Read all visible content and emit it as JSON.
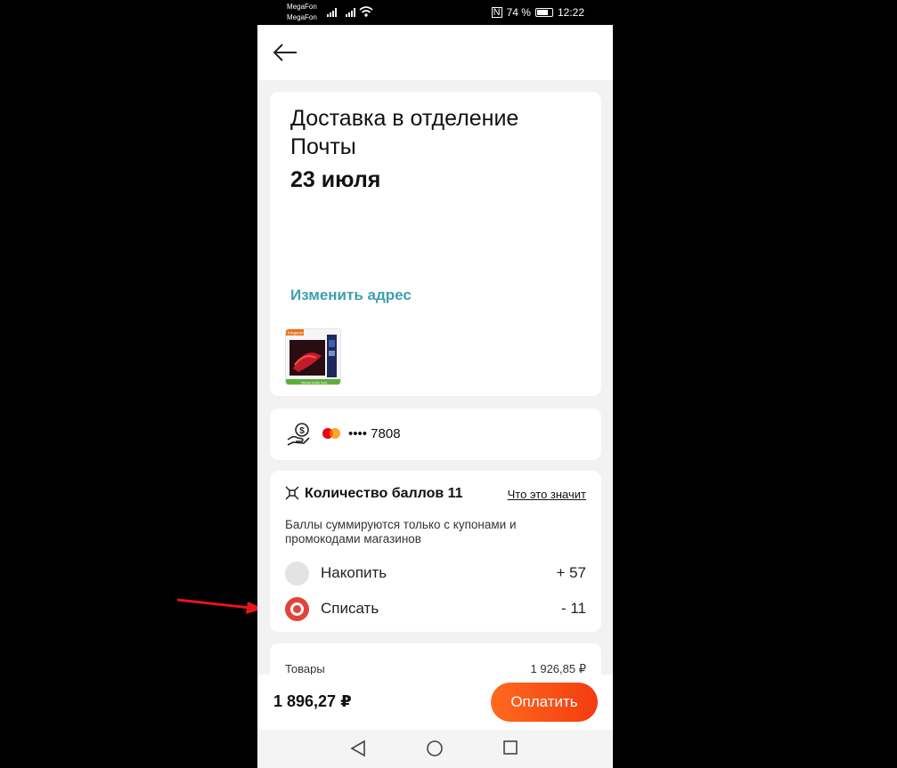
{
  "status": {
    "carrier1": "MegaFon",
    "carrier2": "MegaFon",
    "battery": "74 %",
    "battery_level": 0.74,
    "time": "12:22"
  },
  "delivery": {
    "title": "Доставка в отделение Почты",
    "date": "23 июля",
    "change_address": "Изменить адрес",
    "thumb_badge": "Kingston",
    "thumb_caption": "256GB NVMe SSD"
  },
  "payment": {
    "card_masked": "•••• 7808"
  },
  "points": {
    "title": "Количество баллов 11",
    "what_link": "Что это значит",
    "description": "Баллы суммируются только с купонами и промокодами магазинов",
    "options": [
      {
        "label": "Накопить",
        "value": "+ 57",
        "selected": false
      },
      {
        "label": "Списать",
        "value": "- 11",
        "selected": true
      }
    ]
  },
  "summary": {
    "goods_label": "Товары",
    "goods_value": "1 926,85 ₽"
  },
  "footer": {
    "total": "1 896,27 ₽",
    "pay_label": "Оплатить"
  },
  "colors": {
    "accent": "#f2551c",
    "link": "#3f9fb0",
    "radio_selected": "#e0443a",
    "annotation_arrow": "#e8141c"
  }
}
